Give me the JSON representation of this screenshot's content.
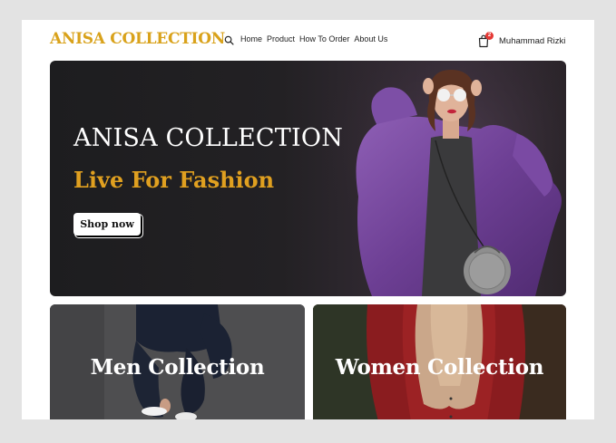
{
  "header": {
    "brand": "ANISA COLLECTION",
    "search_icon": "search-icon",
    "nav": [
      "Home",
      "Product",
      "How To Order",
      "About Us"
    ],
    "cart_icon": "shopping-bag-icon",
    "cart_count": "2",
    "user_name": "Muhammad Rizki"
  },
  "hero": {
    "title": "ANISA COLLECTION",
    "subtitle": "Live For Fashion",
    "button_label": "Shop now"
  },
  "collections": [
    {
      "label": "Men Collection"
    },
    {
      "label": "Women Collection"
    }
  ],
  "colors": {
    "brand": "#d9a21b",
    "accent": "#e0a020",
    "badge": "#e53935",
    "page_bg": "#e3e3e3"
  }
}
